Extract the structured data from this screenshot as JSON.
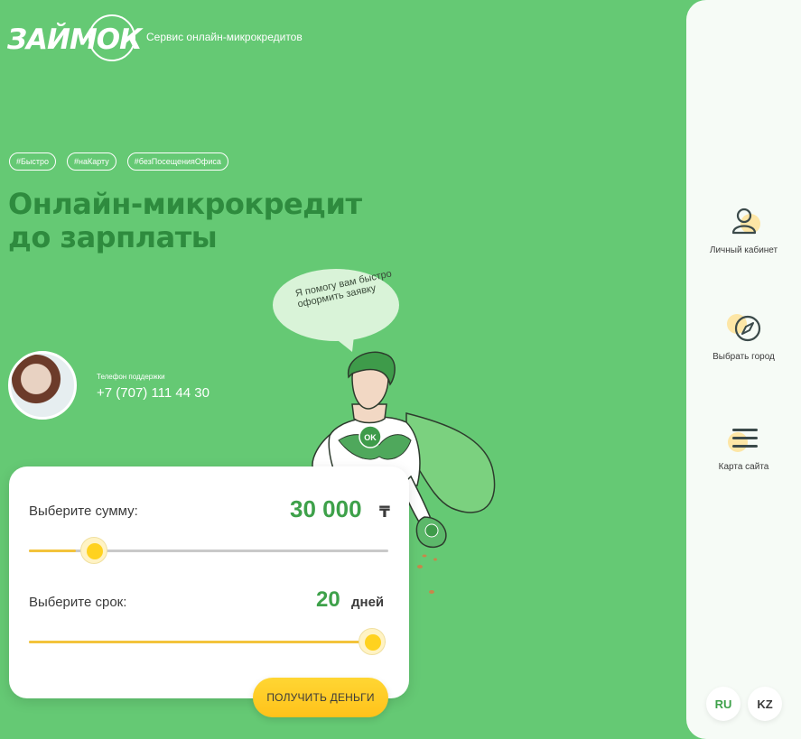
{
  "header": {
    "logo_text": "ЗАЙМОК",
    "tagline": "Сервис онлайн-микрокредитов"
  },
  "hero": {
    "tags": [
      "#Быстро",
      "#наКарту",
      "#безПосещенияОфиса"
    ],
    "headline": "Онлайн-микрокредит до зарплаты",
    "speech_bubble": "Я помогу вам быстро оформить заявку",
    "mascot_badge": "OK"
  },
  "support": {
    "label": "Телефон поддержки",
    "phone": "+7 (707) 111 44 30"
  },
  "calculator": {
    "amount_label": "Выберите сумму:",
    "amount_value": "30 000",
    "amount_currency": "₸",
    "amount_fraction": 0.13,
    "term_label": "Выберите срок:",
    "term_value": "20",
    "term_unit": "дней",
    "term_fraction": 1.0,
    "submit_label": "ПОЛУЧИТЬ ДЕНЬГИ"
  },
  "sidebar": {
    "items": [
      {
        "label": "Личный кабинет",
        "icon": "user-icon"
      },
      {
        "label": "Выбрать город",
        "icon": "compass-icon"
      },
      {
        "label": "Карта сайта",
        "icon": "menu-icon"
      }
    ],
    "languages": [
      "RU",
      "KZ"
    ],
    "active_language": "RU"
  },
  "colors": {
    "background": "#65c974",
    "headline": "#2e8b3e",
    "accent_green": "#3ea14a",
    "accent_yellow": "#ffd21f",
    "sidebar_bg": "#f6fbf6"
  }
}
